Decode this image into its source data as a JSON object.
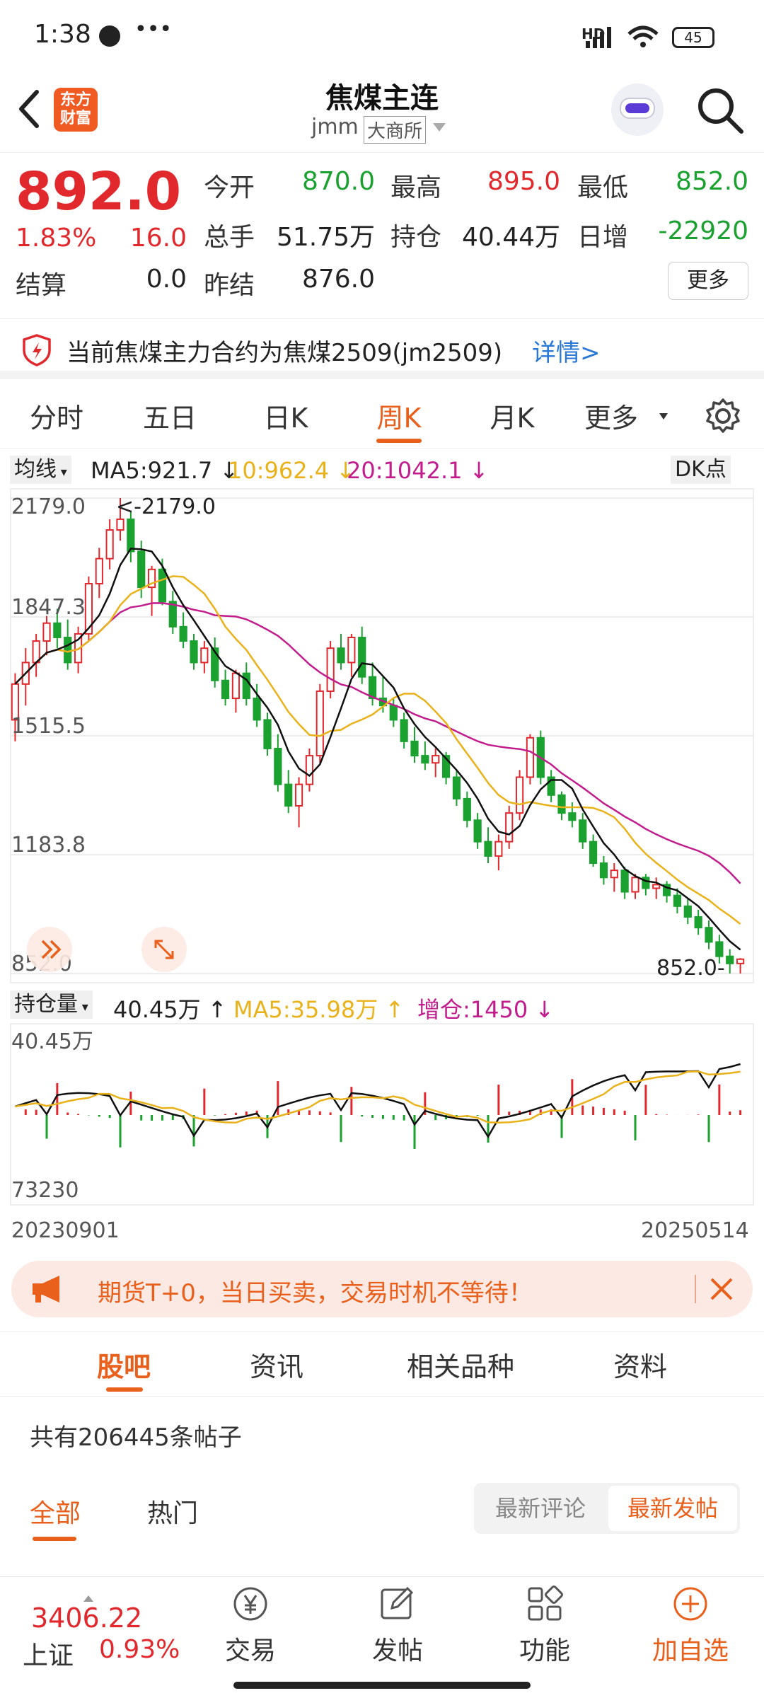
{
  "status_bar": {
    "time": "1:38",
    "dots": "•••",
    "network": "HD",
    "battery": "45"
  },
  "header": {
    "title": "焦煤主连",
    "code": "jmm",
    "exchange": "大商所",
    "logo_text": "东方\n财富"
  },
  "quote": {
    "price": "892.0",
    "change_pct": "1.83%",
    "change": "16.0",
    "settle_label": "结算",
    "settle": "0.0",
    "open_label": "今开",
    "open": "870.0",
    "high_label": "最高",
    "high": "895.0",
    "low_label": "最低",
    "low": "852.0",
    "volume_label": "总手",
    "volume": "51.75万",
    "oi_label": "持仓",
    "oi": "40.44万",
    "oi_change_label": "日增",
    "oi_change": "-22920",
    "prev_settle_label": "昨结",
    "prev_settle": "876.0",
    "more_button": "更多"
  },
  "notice": {
    "text": "当前焦煤主力合约为焦煤2509(jm2509)",
    "link": "详情>"
  },
  "period_tabs": [
    "分时",
    "五日",
    "日K",
    "周K",
    "月K",
    "更多"
  ],
  "period_active": 3,
  "ma_row": {
    "selector": "均线",
    "ma5": "MA5:921.7",
    "ma10": "10:962.4",
    "ma20": "20:1042.1",
    "dk": "DK点"
  },
  "chart_data": {
    "type": "candlestick",
    "y_ticks": [
      "2179.0",
      "1847.3",
      "1515.5",
      "1183.8",
      "852.0"
    ],
    "ylim": [
      852.0,
      2179.0
    ],
    "max_label": "<-2179.0",
    "min_label": "852.0-",
    "x_start": "20230901",
    "x_end": "20250514",
    "candles": [
      [
        1560,
        1690,
        1500,
        1660
      ],
      [
        1660,
        1760,
        1600,
        1720
      ],
      [
        1720,
        1800,
        1680,
        1780
      ],
      [
        1780,
        1850,
        1740,
        1830
      ],
      [
        1830,
        1870,
        1760,
        1790
      ],
      [
        1790,
        1840,
        1700,
        1720
      ],
      [
        1720,
        1820,
        1690,
        1800
      ],
      [
        1800,
        1960,
        1780,
        1940
      ],
      [
        1940,
        2040,
        1900,
        2010
      ],
      [
        2010,
        2120,
        1980,
        2090
      ],
      [
        2090,
        2179,
        2060,
        2120
      ],
      [
        2120,
        2140,
        2000,
        2030
      ],
      [
        2030,
        2060,
        1900,
        1930
      ],
      [
        1930,
        1990,
        1850,
        1980
      ],
      [
        1980,
        2010,
        1880,
        1890
      ],
      [
        1890,
        1920,
        1800,
        1820
      ],
      [
        1820,
        1860,
        1760,
        1780
      ],
      [
        1780,
        1800,
        1700,
        1720
      ],
      [
        1720,
        1780,
        1690,
        1760
      ],
      [
        1760,
        1790,
        1650,
        1670
      ],
      [
        1670,
        1700,
        1600,
        1620
      ],
      [
        1620,
        1700,
        1580,
        1690
      ],
      [
        1690,
        1720,
        1600,
        1620
      ],
      [
        1620,
        1660,
        1540,
        1560
      ],
      [
        1560,
        1580,
        1460,
        1480
      ],
      [
        1480,
        1520,
        1360,
        1380
      ],
      [
        1380,
        1420,
        1300,
        1320
      ],
      [
        1320,
        1400,
        1260,
        1380
      ],
      [
        1380,
        1480,
        1360,
        1460
      ],
      [
        1460,
        1660,
        1440,
        1640
      ],
      [
        1640,
        1780,
        1620,
        1760
      ],
      [
        1760,
        1800,
        1700,
        1720
      ],
      [
        1720,
        1800,
        1680,
        1790
      ],
      [
        1790,
        1820,
        1660,
        1680
      ],
      [
        1680,
        1720,
        1600,
        1620
      ],
      [
        1620,
        1680,
        1580,
        1600
      ],
      [
        1600,
        1620,
        1540,
        1560
      ],
      [
        1560,
        1580,
        1480,
        1500
      ],
      [
        1500,
        1540,
        1440,
        1460
      ],
      [
        1460,
        1500,
        1420,
        1440
      ],
      [
        1440,
        1480,
        1400,
        1460
      ],
      [
        1460,
        1470,
        1380,
        1400
      ],
      [
        1400,
        1420,
        1320,
        1340
      ],
      [
        1340,
        1360,
        1260,
        1280
      ],
      [
        1280,
        1300,
        1200,
        1220
      ],
      [
        1220,
        1260,
        1160,
        1180
      ],
      [
        1180,
        1240,
        1140,
        1220
      ],
      [
        1220,
        1320,
        1200,
        1300
      ],
      [
        1300,
        1420,
        1280,
        1400
      ],
      [
        1400,
        1520,
        1380,
        1510
      ],
      [
        1510,
        1530,
        1380,
        1400
      ],
      [
        1400,
        1420,
        1330,
        1350
      ],
      [
        1350,
        1360,
        1280,
        1300
      ],
      [
        1300,
        1330,
        1260,
        1280
      ],
      [
        1280,
        1300,
        1200,
        1220
      ],
      [
        1220,
        1240,
        1150,
        1160
      ],
      [
        1160,
        1180,
        1100,
        1120
      ],
      [
        1120,
        1160,
        1080,
        1140
      ],
      [
        1140,
        1150,
        1060,
        1080
      ],
      [
        1080,
        1130,
        1060,
        1120
      ],
      [
        1120,
        1130,
        1070,
        1090
      ],
      [
        1090,
        1120,
        1060,
        1100
      ],
      [
        1100,
        1110,
        1050,
        1070
      ],
      [
        1070,
        1090,
        1020,
        1040
      ],
      [
        1040,
        1060,
        990,
        1010
      ],
      [
        1010,
        1030,
        960,
        980
      ],
      [
        980,
        1000,
        920,
        940
      ],
      [
        940,
        960,
        880,
        900
      ],
      [
        900,
        920,
        852,
        880
      ],
      [
        880,
        895,
        852,
        892
      ]
    ],
    "ma_colors": {
      "ma5": "#111111",
      "ma10": "#e9b21a",
      "ma20": "#c21d8c"
    }
  },
  "oi_row": {
    "selector": "持仓量",
    "value": "40.45万",
    "ma5": "MA5:35.98万",
    "change": "增仓:1450"
  },
  "oi_chart": {
    "y_top": "40.45万",
    "y_bottom": "73230"
  },
  "banner": {
    "text": "期货T+0，当日买卖，交易时机不等待！"
  },
  "sub_tabs": [
    "股吧",
    "资讯",
    "相关品种",
    "资料"
  ],
  "posts": {
    "count_text": "共有206445条帖子",
    "filter_all": "全部",
    "filter_hot": "热门",
    "sort_comment": "最新评论",
    "sort_post": "最新发帖"
  },
  "bottom": {
    "index_value": "3406.22",
    "index_name": "上证",
    "index_pct": "0.93%",
    "trade": "交易",
    "post": "发帖",
    "func": "功能",
    "add": "加自选"
  },
  "colors": {
    "up": "#e0282d",
    "down": "#1aa130",
    "accent": "#e8601c"
  }
}
